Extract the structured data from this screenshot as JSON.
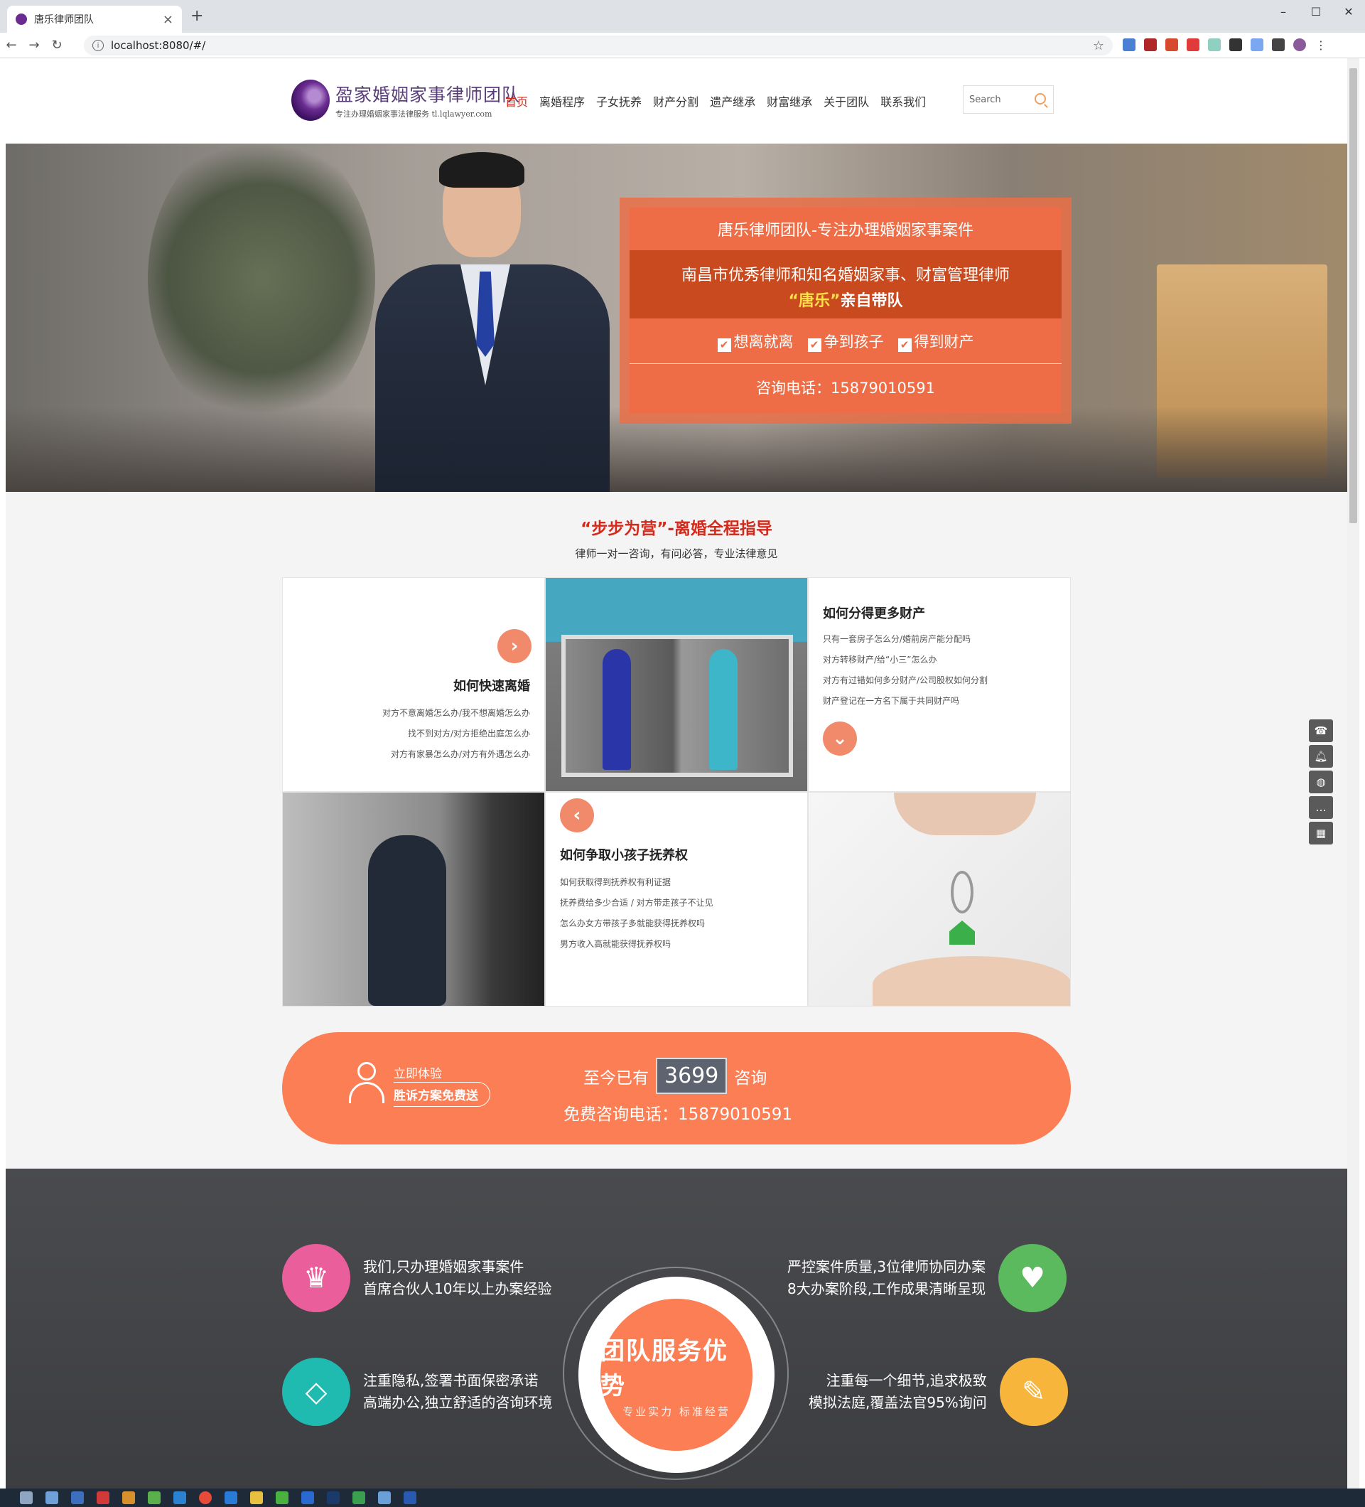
{
  "browser": {
    "tab_title": "唐乐律师团队",
    "tab_close": "×",
    "new_tab": "+",
    "url": "localhost:8080/#/",
    "win_min": "–",
    "win_max": "☐",
    "win_close": "✕"
  },
  "header": {
    "logo_title": "盈家婚姻家事律师团队",
    "logo_subtitle": "专注办理婚姻家事法律服务 tl.lqlawyer.com",
    "nav": [
      "首页",
      "离婚程序",
      "子女抚养",
      "财产分割",
      "遗产继承",
      "财富继承",
      "关于团队",
      "联系我们"
    ],
    "active_nav": "首页",
    "search_placeholder": "Search"
  },
  "hero": {
    "line1": "唐乐律师团队-专注办理婚姻家事案件",
    "line2": "南昌市优秀律师和知名婚姻家事、财富管理律师",
    "line3_highlight": "“唐乐”",
    "line3_rest": "亲自带队",
    "checks": [
      "想离就离",
      "争到孩子",
      "得到财产"
    ],
    "phone_line": "咨询电话：15879010591"
  },
  "steps": {
    "title": "“步步为营”-离婚全程指导",
    "subtitle": "律师一对一咨询，有问必答，专业法律意见",
    "divorce": {
      "heading": "如何快速离婚",
      "items": [
        "对方不意离婚怎么办/我不想离婚怎么办",
        "找不到对方/对方拒绝出庭怎么办",
        "对方有家暴怎么办/对方有外遇怎么办"
      ],
      "icon": "chevron-right-icon"
    },
    "property": {
      "heading": "如何分得更多财产",
      "items": [
        "只有一套房子怎么分/婚前房产能分配吗",
        "对方转移财产/给“小三”怎么办",
        "对方有过错如何多分财产/公司股权如何分割",
        "财产登记在一方名下属于共同财产吗"
      ],
      "icon": "chevron-down-icon"
    },
    "custody": {
      "heading": "如何争取小孩子抚养权",
      "items": [
        "如何获取得到抚养权有利证据",
        "抚养费给多少合适 / 对方带走孩子不让见",
        "怎么办女方带孩子多就能获得抚养权吗",
        "男方收入高就能获得抚养权吗"
      ],
      "icon": "chevron-left-icon"
    }
  },
  "cta": {
    "try_line1": "立即体验",
    "try_line2": "胜诉方案免费送",
    "count_prefix": "至今已有",
    "count_value": "3699",
    "count_suffix": "咨询",
    "phone": "免费咨询电话：15879010591"
  },
  "advantages": {
    "badge_title": "团队服务优势",
    "badge_sub": "专业实力 标准经营",
    "items": [
      {
        "line1": "我们,只办理婚姻家事案件",
        "line2": "首席合伙人10年以上办案经验",
        "icon": "crown-icon",
        "color": "#ea5f9b"
      },
      {
        "line1": "严控案件质量,3位律师协同办案",
        "line2": "8大办案阶段,工作成果清晰呈现",
        "icon": "heart-icon",
        "color": "#5cba5e"
      },
      {
        "line1": "注重隐私,签署书面保密承诺",
        "line2": "高端办公,独立舒适的咨询环境",
        "icon": "diamond-icon",
        "color": "#1fbab0"
      },
      {
        "line1": "注重每一个细节,追求极致",
        "line2": "模拟法庭,覆盖法官95%询问",
        "icon": "edit-icon",
        "color": "#f7b53b"
      }
    ]
  },
  "tools": [
    "phone-icon",
    "bell-icon",
    "wechat-icon",
    "chat-icon",
    "qrcode-icon"
  ],
  "colors": {
    "accent": "#fb7e55",
    "nav_active": "#d22b1e",
    "title_red": "#d22b1e"
  }
}
